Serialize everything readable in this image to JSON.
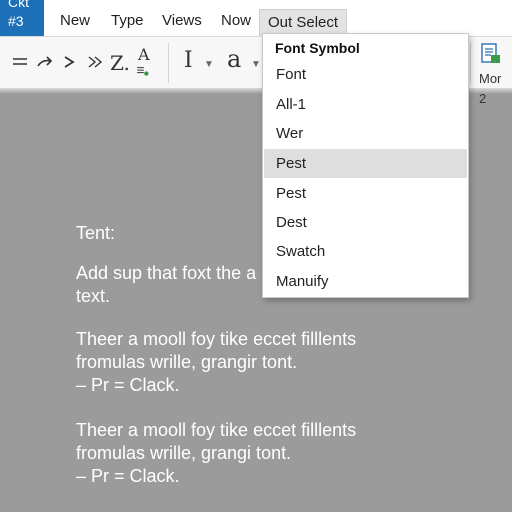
{
  "app_badge": {
    "line1": "Ckt",
    "line2": "#3"
  },
  "menubar": {
    "items": [
      "New",
      "Type",
      "Views",
      "Now",
      "Out Select"
    ]
  },
  "toolbar": {
    "z_label": "Z.",
    "a_label": "A",
    "ibeam_label": "I",
    "a_script_label": "a",
    "right_button_label": "Mor 2"
  },
  "dropdown": {
    "header": "Font Symbol",
    "items": [
      "Font",
      "All-1",
      "Wer",
      "Pest",
      "Pest",
      "Dest",
      "Swatch",
      "Manuify"
    ],
    "selected_index": 3
  },
  "document": {
    "heading": "Tent:",
    "intro_lines": [
      "Add sup that foxt the a",
      "text."
    ],
    "paragraphs": [
      {
        "lines": [
          "Theer a mooll foy tike eccet filllents",
          "fromulas wrille, grangir tont.",
          "– Pr = Clack."
        ]
      },
      {
        "lines": [
          "Theer a mooll foy tike eccet filllents",
          "fromulas wrille, grangi tont.",
          "– Pr = Clack."
        ]
      }
    ]
  },
  "colors": {
    "accent": "#1d6fb8",
    "canvas": "#9b9b9b",
    "selection": "#dedede"
  },
  "icons": [
    "lines-icon",
    "redo-arrow-icon",
    "chevron-right-icon",
    "double-chevron-right-icon",
    "text-style-icon",
    "caret-down-icon",
    "document-icon"
  ]
}
